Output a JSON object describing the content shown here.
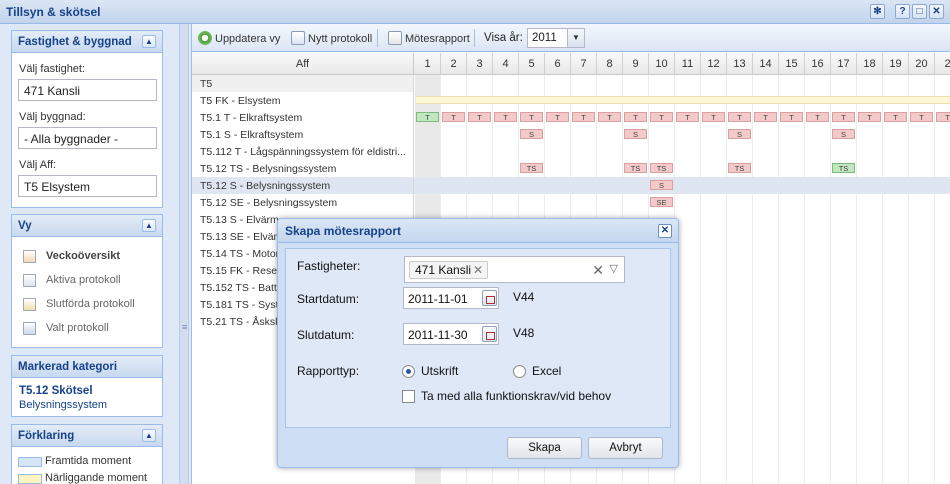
{
  "app": {
    "title": "Tillsyn & skötsel"
  },
  "titlebar_tools": [
    "gear-icon",
    "help-icon",
    "maximize-icon",
    "close-icon"
  ],
  "sidebar": {
    "fastighet_panel": {
      "title": "Fastighet & byggnad",
      "fastighet_label": "Välj fastighet:",
      "fastighet_value": "471 Kansli",
      "byggnad_label": "Välj byggnad:",
      "byggnad_value": "- Alla byggnader -",
      "aff_label": "Välj Aff:",
      "aff_value": "T5 Elsystem"
    },
    "vy_panel": {
      "title": "Vy",
      "items": [
        {
          "label": "Veckoöversikt",
          "icon": "calendar-icon"
        },
        {
          "label": "Aktiva protokoll",
          "icon": "document-icon"
        },
        {
          "label": "Slutförda protokoll",
          "icon": "document-check-icon"
        },
        {
          "label": "Valt protokoll",
          "icon": "list-icon"
        }
      ]
    },
    "kategori_panel": {
      "title": "Markerad kategori",
      "name": "T5.12 Skötsel",
      "sub": "Belysningssystem"
    },
    "legend_panel": {
      "title": "Förklaring",
      "items": [
        {
          "label": "Framtida moment",
          "color": "#d6e4f7"
        },
        {
          "label": "Närliggande moment",
          "color": "#fff4c0"
        }
      ]
    }
  },
  "toolbar": {
    "update_label": "Uppdatera vy",
    "new_protocol_label": "Nytt protokoll",
    "report_label": "Mötesrapport",
    "year_label": "Visa år:",
    "year_value": "2011"
  },
  "grid": {
    "aff_header": "Aff",
    "weeks": [
      "1",
      "2",
      "3",
      "4",
      "5",
      "6",
      "7",
      "8",
      "9",
      "10",
      "11",
      "12",
      "13",
      "14",
      "15",
      "16",
      "17",
      "18",
      "19",
      "20",
      "2"
    ],
    "rows": [
      {
        "label": "T5",
        "type": "group",
        "marks": []
      },
      {
        "label": "T5 FK - Elsystem",
        "type": "band",
        "marks": []
      },
      {
        "label": "T5.1 T - Elkraftsystem",
        "type": "row",
        "marks": [
          {
            "week": 1,
            "text": "T",
            "green": true
          },
          {
            "week": 2,
            "text": "T"
          },
          {
            "week": 3,
            "text": "T"
          },
          {
            "week": 4,
            "text": "T"
          },
          {
            "week": 5,
            "text": "T"
          },
          {
            "week": 6,
            "text": "T"
          },
          {
            "week": 7,
            "text": "T"
          },
          {
            "week": 8,
            "text": "T"
          },
          {
            "week": 9,
            "text": "T"
          },
          {
            "week": 10,
            "text": "T"
          },
          {
            "week": 11,
            "text": "T"
          },
          {
            "week": 12,
            "text": "T"
          },
          {
            "week": 13,
            "text": "T"
          },
          {
            "week": 14,
            "text": "T"
          },
          {
            "week": 15,
            "text": "T"
          },
          {
            "week": 16,
            "text": "T"
          },
          {
            "week": 17,
            "text": "T"
          },
          {
            "week": 18,
            "text": "T"
          },
          {
            "week": 19,
            "text": "T"
          },
          {
            "week": 20,
            "text": "T"
          },
          {
            "week": 21,
            "text": "T"
          }
        ]
      },
      {
        "label": "T5.1 S - Elkraftsystem",
        "type": "row",
        "marks": [
          {
            "week": 5,
            "text": "S"
          },
          {
            "week": 9,
            "text": "S"
          },
          {
            "week": 13,
            "text": "S"
          },
          {
            "week": 17,
            "text": "S"
          }
        ]
      },
      {
        "label": "T5.112 T - Lågspänningssystem för eldistri...",
        "type": "row",
        "marks": []
      },
      {
        "label": "T5.12 TS - Belysningssystem",
        "type": "row",
        "marks": [
          {
            "week": 5,
            "text": "TS"
          },
          {
            "week": 9,
            "text": "TS"
          },
          {
            "week": 10,
            "text": "TS"
          },
          {
            "week": 13,
            "text": "TS"
          },
          {
            "week": 17,
            "text": "TS",
            "green": true
          }
        ]
      },
      {
        "label": "T5.12 S - Belysningssystem",
        "type": "selected",
        "marks": [
          {
            "week": 10,
            "text": "S"
          }
        ]
      },
      {
        "label": "T5.12 SE - Belysningssystem",
        "type": "row",
        "marks": [
          {
            "week": 10,
            "text": "SE"
          }
        ]
      },
      {
        "label": "T5.13 S - Elvärm",
        "type": "row",
        "marks": []
      },
      {
        "label": "T5.13 SE - Elvärm",
        "type": "row",
        "marks": []
      },
      {
        "label": "T5.14 TS - Motor",
        "type": "row",
        "marks": []
      },
      {
        "label": "T5.15 FK - Reser",
        "type": "row",
        "marks": []
      },
      {
        "label": "T5.152 TS - Batt",
        "type": "row",
        "marks": []
      },
      {
        "label": "T5.181 TS - Syst",
        "type": "row",
        "marks": []
      },
      {
        "label": "T5.21 TS - Åsksk",
        "type": "row",
        "marks": []
      }
    ]
  },
  "dialog": {
    "title": "Skapa mötesrapport",
    "fastigheter_label": "Fastigheter:",
    "fastigheter_tag": "471 Kansli",
    "start_label": "Startdatum:",
    "start_value": "2011-11-01",
    "start_week": "V44",
    "end_label": "Slutdatum:",
    "end_value": "2011-11-30",
    "end_week": "V48",
    "type_label": "Rapporttyp:",
    "type_options": [
      "Utskrift",
      "Excel"
    ],
    "type_selected": "Utskrift",
    "checkbox_label": "Ta med alla funktionskrav/vid behov",
    "checkbox_checked": false,
    "create_button": "Skapa",
    "cancel_button": "Avbryt"
  },
  "colors": {
    "mark_pink": "#f3c9c9",
    "mark_green": "#bfe8bf",
    "band_yellow": "#fff8d8",
    "header_blue": "#15428b"
  }
}
